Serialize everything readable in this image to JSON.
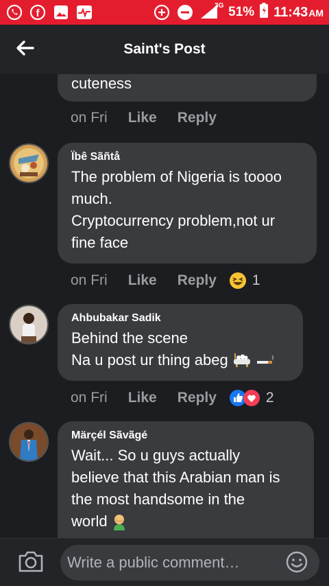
{
  "status_bar": {
    "network": "3G",
    "battery": "51%",
    "time": "11:43",
    "ampm": "AM"
  },
  "header": {
    "title": "Saint's Post"
  },
  "comments": [
    {
      "author": "",
      "text_lines": [
        "cuteness"
      ],
      "time": "on Fri",
      "like_label": "Like",
      "reply_label": "Reply",
      "reaction_count": ""
    },
    {
      "author": "Ïbê Sãñtå",
      "text_lines": [
        "The problem of Nigeria is toooo",
        "much.",
        "Cryptocurrency problem,not ur",
        "fine face"
      ],
      "time": "on Fri",
      "like_label": "Like",
      "reply_label": "Reply",
      "reaction_icons": [
        "laughing-emoji"
      ],
      "reaction_count": "1"
    },
    {
      "author": "Ahbubakar Sadik",
      "text_lines": [
        "Behind the scene",
        "Na u post ur thing abeg"
      ],
      "time": "on Fri",
      "like_label": "Like",
      "reply_label": "Reply",
      "reaction_icons": [
        "like-reaction",
        "love-reaction"
      ],
      "reaction_count": "2"
    },
    {
      "author": "Märçél Sãvãgé",
      "text_lines": [
        "Wait... So u guys actually",
        "believe that this Arabian man is",
        "the most handsome in the",
        "world"
      ],
      "time": "",
      "like_label": "",
      "reply_label": "",
      "reaction_count": ""
    }
  ],
  "comment_bar": {
    "placeholder": "Write a public comment…"
  },
  "colors": {
    "status_bar": "#e41d2e",
    "background": "#1c1d20",
    "bubble": "#3a3b3e",
    "meta_text": "#9a9ca0"
  }
}
